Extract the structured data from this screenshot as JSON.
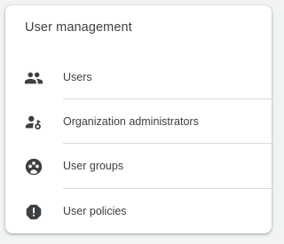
{
  "card": {
    "title": "User management",
    "items": [
      {
        "label": "Users",
        "icon": "users-icon"
      },
      {
        "label": "Organization administrators",
        "icon": "admin-user-icon"
      },
      {
        "label": "User groups",
        "icon": "user-groups-icon"
      },
      {
        "label": "User policies",
        "icon": "policy-alert-icon"
      }
    ]
  },
  "colors": {
    "icon": "#3c4043",
    "text": "#3c4043",
    "divider": "#dadce0",
    "background": "#f1f3f4",
    "card": "#ffffff"
  }
}
